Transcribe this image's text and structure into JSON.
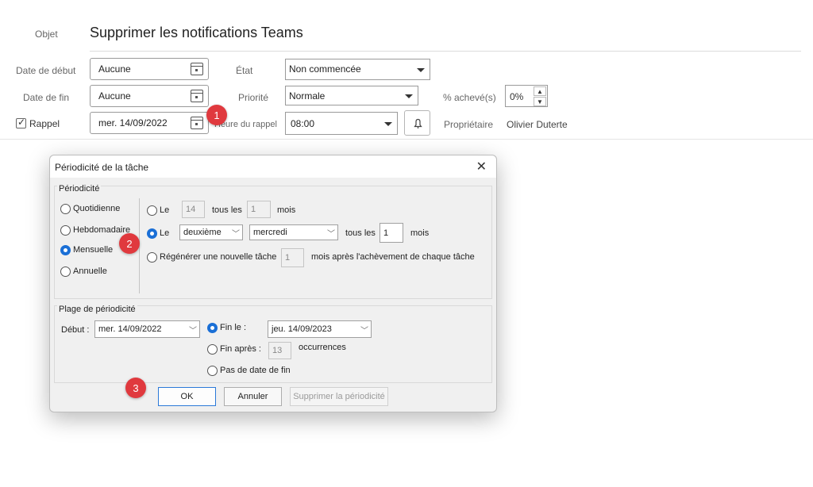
{
  "form": {
    "subject_label": "Objet",
    "subject_value": "Supprimer les notifications Teams",
    "start_label": "Date de début",
    "start_value": "Aucune",
    "end_label": "Date de fin",
    "end_value": "Aucune",
    "reminder_label": "Rappel",
    "reminder_checked": true,
    "reminder_date": "mer. 14/09/2022",
    "state_label": "État",
    "state_value": "Non commencée",
    "priority_label": "Priorité",
    "priority_value": "Normale",
    "reminder_time_label": "Heure du rappel",
    "reminder_time_value": "08:00",
    "percent_label": "% achevé(s)",
    "percent_value": "0%",
    "owner_label": "Propriétaire",
    "owner_value": "Olivier Duterte"
  },
  "badges": {
    "b1": "1",
    "b2": "2",
    "b3": "3"
  },
  "dialog": {
    "title": "Périodicité de la tâche",
    "recurrence_group": "Périodicité",
    "freq_options": [
      "Quotidienne",
      "Hebdomadaire",
      "Mensuelle",
      "Annuelle"
    ],
    "freq_selected": "Mensuelle",
    "opt1": {
      "le": "Le",
      "day": "14",
      "every": "tous les",
      "months_n": "1",
      "months": "mois"
    },
    "opt2": {
      "le": "Le",
      "ordinal": "deuxième",
      "weekday": "mercredi",
      "every": "tous les",
      "months_n": "1",
      "months": "mois"
    },
    "opt3": {
      "label": "Régénérer une nouvelle tâche",
      "n": "1",
      "suffix": "mois après l'achèvement de chaque tâche"
    },
    "range_group": "Plage de périodicité",
    "start_label": "Début :",
    "start_value": "mer. 14/09/2022",
    "end_by_label": "Fin le :",
    "end_by_value": "jeu. 14/09/2023",
    "end_after_label": "Fin après :",
    "end_after_n": "13",
    "occurrences": "occurrences",
    "no_end_label": "Pas de date de fin",
    "ok": "OK",
    "cancel": "Annuler",
    "remove": "Supprimer la périodicité"
  },
  "colors": {
    "accent": "#1a6fd6",
    "badge": "#e0393e"
  }
}
